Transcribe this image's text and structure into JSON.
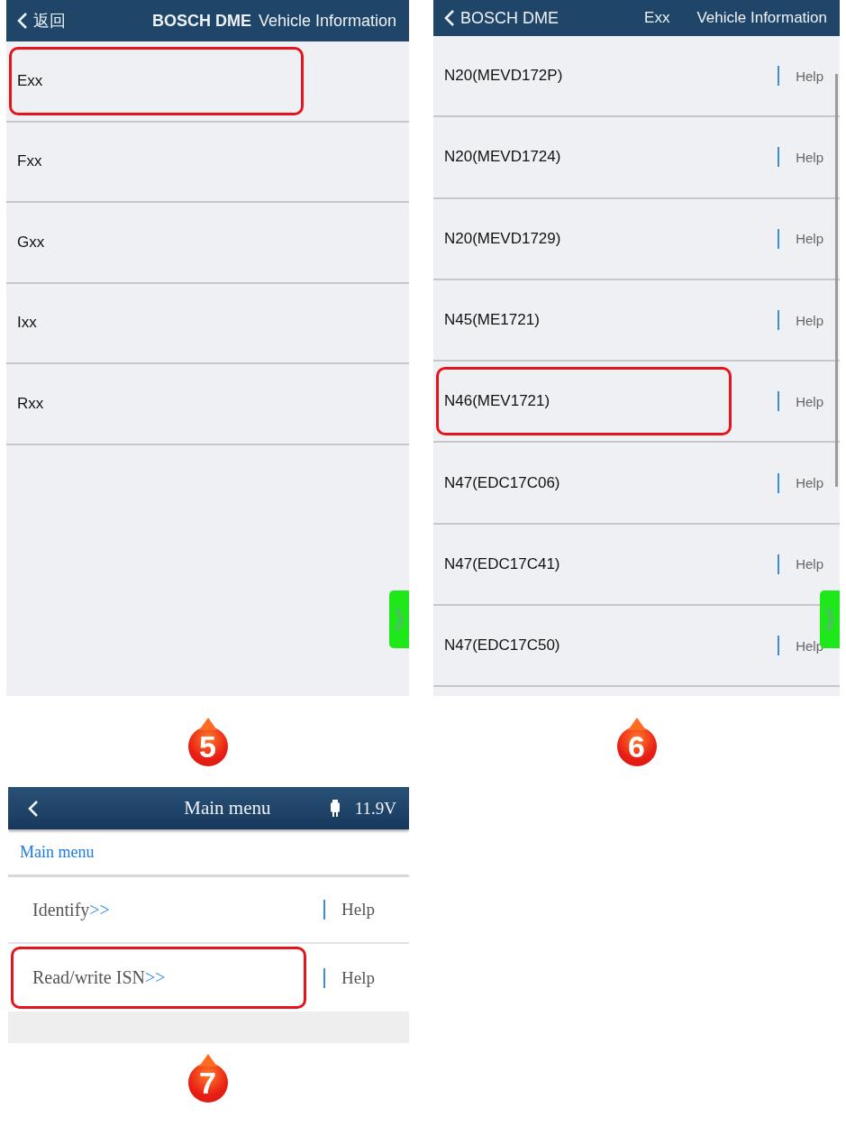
{
  "panels": [
    {
      "kind": "groups",
      "header": {
        "back": "返回",
        "title_bold": "BOSCH DME",
        "title": "Vehicle Information"
      },
      "slide_tab": true,
      "items": [
        {
          "label": "Exx",
          "highlighted": true
        },
        {
          "label": "Fxx",
          "highlighted": false
        },
        {
          "label": "Gxx",
          "highlighted": false
        },
        {
          "label": "Ixx",
          "highlighted": false
        },
        {
          "label": "Rxx",
          "highlighted": false
        }
      ],
      "badge": "5"
    },
    {
      "kind": "models",
      "header": {
        "back": "BOSCH DME",
        "title_bold": "Exx",
        "title": "Vehicle Information"
      },
      "slide_tab": true,
      "scrollbar": true,
      "items": [
        {
          "label": "N20(MEVD172P)",
          "help": "Help",
          "highlighted": false
        },
        {
          "label": "N20(MEVD1724)",
          "help": "Help",
          "highlighted": false
        },
        {
          "label": "N20(MEVD1729)",
          "help": "Help",
          "highlighted": false
        },
        {
          "label": "N45(ME1721)",
          "help": "Help",
          "highlighted": false
        },
        {
          "label": "N46(MEV1721)",
          "help": "Help",
          "highlighted": true
        },
        {
          "label": "N47(EDC17C06)",
          "help": "Help",
          "highlighted": false
        },
        {
          "label": "N47(EDC17C41)",
          "help": "Help",
          "highlighted": false
        },
        {
          "label": "N47(EDC17C50)",
          "help": "Help",
          "highlighted": false
        }
      ],
      "badge": "6"
    },
    {
      "kind": "menu",
      "header": {
        "title": "Main menu",
        "voltage": "11.9V"
      },
      "breadcrumb": "Main menu",
      "items": [
        {
          "label": "Identify",
          "arrow": ">>",
          "help": "Help",
          "highlighted": false
        },
        {
          "label": "Read/write ISN",
          "arrow": ">>",
          "help": "Help",
          "highlighted": true
        }
      ],
      "badge": "7"
    }
  ]
}
